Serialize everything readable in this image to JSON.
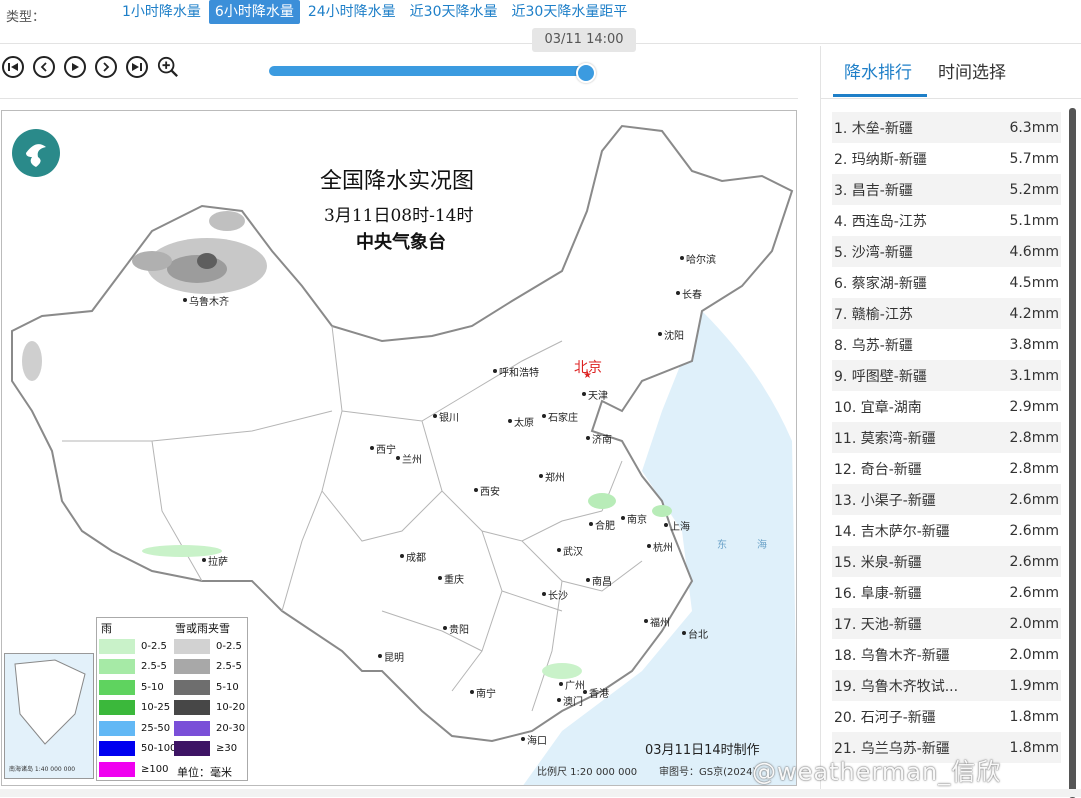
{
  "type_bar": {
    "label": "类型：",
    "tabs": [
      {
        "label": "1小时降水量",
        "active": false
      },
      {
        "label": "6小时降水量",
        "active": true
      },
      {
        "label": "24小时降水量",
        "active": false
      },
      {
        "label": "近30天降水量",
        "active": false
      },
      {
        "label": "近30天降水量距平",
        "active": false
      }
    ]
  },
  "player": {
    "tooltip": "03/11 14:00",
    "progress": 1.0,
    "icons": [
      "first-icon",
      "prev-icon",
      "play-icon",
      "next-icon",
      "last-icon",
      "zoom-in-icon"
    ]
  },
  "map": {
    "title": "全国降水实况图",
    "subtitle": "3月11日08时-14时",
    "issuer": "中央气象台",
    "made_time": "03月11日14时制作",
    "scale": "比例尺 1:20 000 000",
    "review_no": "审图号：GS京(2024)",
    "inset_scale": "南海诸岛 1:40 000 000",
    "cities": [
      {
        "name": "乌鲁木齐",
        "capital": false
      },
      {
        "name": "哈尔滨",
        "capital": false
      },
      {
        "name": "长春",
        "capital": false
      },
      {
        "name": "沈阳",
        "capital": false
      },
      {
        "name": "北京",
        "capital": true
      },
      {
        "name": "天津",
        "capital": false
      },
      {
        "name": "呼和浩特",
        "capital": false
      },
      {
        "name": "石家庄",
        "capital": false
      },
      {
        "name": "太原",
        "capital": false
      },
      {
        "name": "济南",
        "capital": false
      },
      {
        "name": "银川",
        "capital": false
      },
      {
        "name": "西宁",
        "capital": false
      },
      {
        "name": "兰州",
        "capital": false
      },
      {
        "name": "郑州",
        "capital": false
      },
      {
        "name": "西安",
        "capital": false
      },
      {
        "name": "合肥",
        "capital": false
      },
      {
        "name": "南京",
        "capital": false
      },
      {
        "name": "上海",
        "capital": false
      },
      {
        "name": "拉萨",
        "capital": false
      },
      {
        "name": "成都",
        "capital": false
      },
      {
        "name": "武汉",
        "capital": false
      },
      {
        "name": "杭州",
        "capital": false
      },
      {
        "name": "重庆",
        "capital": false
      },
      {
        "name": "长沙",
        "capital": false
      },
      {
        "name": "南昌",
        "capital": false
      },
      {
        "name": "贵阳",
        "capital": false
      },
      {
        "name": "福州",
        "capital": false
      },
      {
        "name": "台北",
        "capital": false
      },
      {
        "name": "昆明",
        "capital": false
      },
      {
        "name": "南宁",
        "capital": false
      },
      {
        "name": "广州",
        "capital": false
      },
      {
        "name": "澳门",
        "capital": false
      },
      {
        "name": "香港",
        "capital": false
      },
      {
        "name": "海口",
        "capital": false
      }
    ],
    "sea_labels": [
      "东",
      "海"
    ],
    "legend": {
      "rain_title": "雨",
      "snow_title": "雪或雨夹雪",
      "unit": "单位：毫米",
      "rain": [
        {
          "label": "0-2.5",
          "color": "#c9f2c9"
        },
        {
          "label": "2.5-5",
          "color": "#a6eaa6"
        },
        {
          "label": "5-10",
          "color": "#5fd35f"
        },
        {
          "label": "10-25",
          "color": "#3bb83b"
        },
        {
          "label": "25-50",
          "color": "#62b8f5"
        },
        {
          "label": "50-100",
          "color": "#0000f0"
        },
        {
          "label": "≥100",
          "color": "#f000f0"
        }
      ],
      "snow": [
        {
          "label": "0-2.5",
          "color": "#d2d2d2"
        },
        {
          "label": "2.5-5",
          "color": "#a8a8a8"
        },
        {
          "label": "5-10",
          "color": "#6e6e6e"
        },
        {
          "label": "10-20",
          "color": "#474747"
        },
        {
          "label": "20-30",
          "color": "#7a4fd8"
        },
        {
          "label": "≥30",
          "color": "#3d1464"
        }
      ]
    }
  },
  "sidebar": {
    "tabs": [
      {
        "label": "降水排行",
        "active": true
      },
      {
        "label": "时间选择",
        "active": false
      }
    ],
    "ranking": [
      {
        "name": "1. 木垒-新疆",
        "value": "6.3mm"
      },
      {
        "name": "2. 玛纳斯-新疆",
        "value": "5.7mm"
      },
      {
        "name": "3. 昌吉-新疆",
        "value": "5.2mm"
      },
      {
        "name": "4. 西连岛-江苏",
        "value": "5.1mm"
      },
      {
        "name": "5. 沙湾-新疆",
        "value": "4.6mm"
      },
      {
        "name": "6. 蔡家湖-新疆",
        "value": "4.5mm"
      },
      {
        "name": "7. 赣榆-江苏",
        "value": "4.2mm"
      },
      {
        "name": "8. 乌苏-新疆",
        "value": "3.8mm"
      },
      {
        "name": "9. 呼图壁-新疆",
        "value": "3.1mm"
      },
      {
        "name": "10. 宜章-湖南",
        "value": "2.9mm"
      },
      {
        "name": "11. 莫索湾-新疆",
        "value": "2.8mm"
      },
      {
        "name": "12. 奇台-新疆",
        "value": "2.8mm"
      },
      {
        "name": "13. 小渠子-新疆",
        "value": "2.6mm"
      },
      {
        "name": "14. 吉木萨尔-新疆",
        "value": "2.6mm"
      },
      {
        "name": "15. 米泉-新疆",
        "value": "2.6mm"
      },
      {
        "name": "16. 阜康-新疆",
        "value": "2.6mm"
      },
      {
        "name": "17. 天池-新疆",
        "value": "2.0mm"
      },
      {
        "name": "18. 乌鲁木齐-新疆",
        "value": "2.0mm"
      },
      {
        "name": "19. 乌鲁木齐牧试...",
        "value": "1.9mm"
      },
      {
        "name": "20. 石河子-新疆",
        "value": "1.8mm"
      },
      {
        "name": "21. 乌兰乌苏-新疆",
        "value": "1.8mm"
      }
    ]
  },
  "watermark": "@weatherman_信欣"
}
